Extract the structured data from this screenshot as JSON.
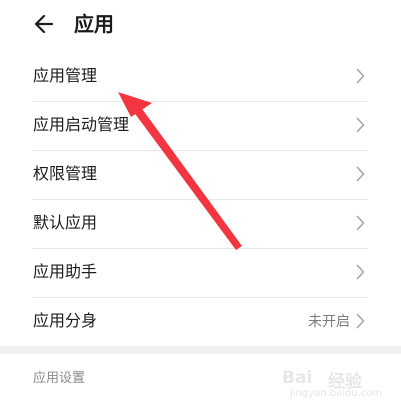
{
  "header": {
    "title": "应用",
    "back_icon": "arrow-left-icon"
  },
  "menu": {
    "items": [
      {
        "label": "应用管理",
        "status": ""
      },
      {
        "label": "应用启动管理",
        "status": ""
      },
      {
        "label": "权限管理",
        "status": ""
      },
      {
        "label": "默认应用",
        "status": ""
      },
      {
        "label": "应用助手",
        "status": ""
      },
      {
        "label": "应用分身",
        "status": "未开启"
      }
    ]
  },
  "settings": {
    "section_title": "应用设置"
  },
  "annotation": {
    "arrow_color": "#f2353f"
  },
  "watermark": {
    "logo": "Bai",
    "suffix": "经验",
    "url": "jingyan.baidu.com"
  }
}
